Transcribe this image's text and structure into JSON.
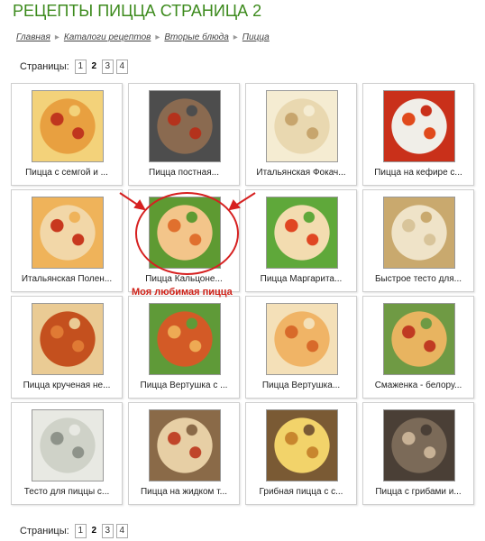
{
  "title": "РЕЦЕПТЫ ПИЦЦА СТРАНИЦА 2",
  "breadcrumb": [
    "Главная",
    "Каталоги рецептов",
    "Вторые блюда",
    "Пицца"
  ],
  "pager": {
    "label": "Страницы:",
    "pages": [
      "1",
      "2",
      "3",
      "4"
    ],
    "current": "2"
  },
  "recipes": [
    {
      "caption": "Пицца с семгой и ..."
    },
    {
      "caption": "Пицца постная..."
    },
    {
      "caption": "Итальянская Фокач..."
    },
    {
      "caption": "Пицца на кефире с..."
    },
    {
      "caption": "Итальянская Полен..."
    },
    {
      "caption": "Пицца Кальцоне..."
    },
    {
      "caption": "Пицца Маргарита..."
    },
    {
      "caption": "Быстрое тесто для..."
    },
    {
      "caption": "Пицца крученая не..."
    },
    {
      "caption": "Пицца Вертушка с ..."
    },
    {
      "caption": "Пицца Вертушка..."
    },
    {
      "caption": "Смаженка - белору..."
    },
    {
      "caption": "Тесто для пиццы с..."
    },
    {
      "caption": "Пицца на жидком т..."
    },
    {
      "caption": "Грибная пицца с с..."
    },
    {
      "caption": "Пицца с грибами и..."
    }
  ],
  "annotation": "Моя любимая пицца"
}
